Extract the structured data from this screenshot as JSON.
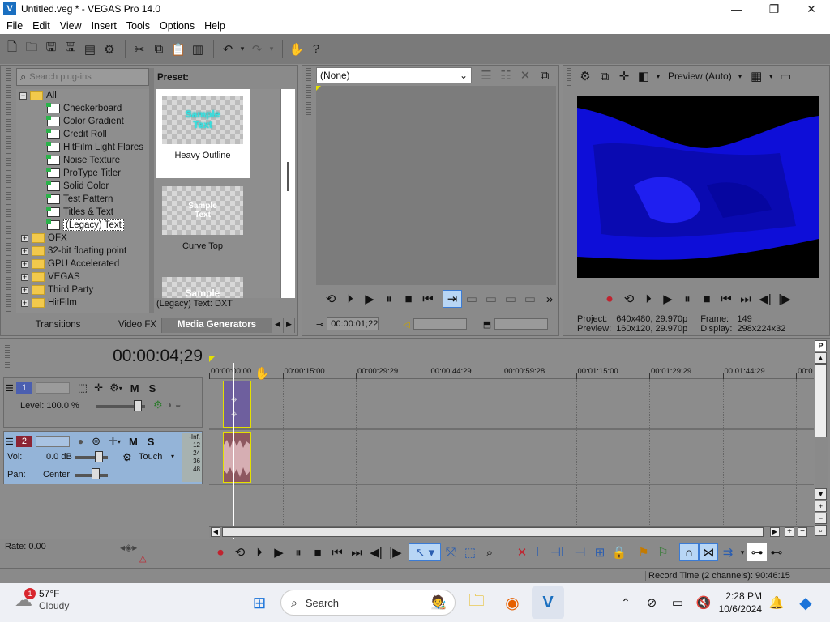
{
  "window": {
    "title": "Untitled.veg * - VEGAS Pro 14.0",
    "icon_letter": "V",
    "minimize": "—",
    "maximize": "❐",
    "close": "✕"
  },
  "menu": [
    "File",
    "Edit",
    "View",
    "Insert",
    "Tools",
    "Options",
    "Help"
  ],
  "explorer": {
    "search_placeholder": "Search plug-ins",
    "preset_label": "Preset:",
    "tree": [
      {
        "label": "All",
        "kind": "folder",
        "expanded": true
      },
      {
        "label": "Checkerboard",
        "kind": "gen"
      },
      {
        "label": "Color Gradient",
        "kind": "gen"
      },
      {
        "label": "Credit Roll",
        "kind": "gen"
      },
      {
        "label": "HitFilm Light Flares",
        "kind": "gen"
      },
      {
        "label": "Noise Texture",
        "kind": "gen"
      },
      {
        "label": "ProType Titler",
        "kind": "gen"
      },
      {
        "label": "Solid Color",
        "kind": "gen"
      },
      {
        "label": "Test Pattern",
        "kind": "gen"
      },
      {
        "label": "Titles & Text",
        "kind": "gen"
      },
      {
        "label": "(Legacy) Text",
        "kind": "gen",
        "selected": true
      },
      {
        "label": "OFX",
        "kind": "folder"
      },
      {
        "label": "32-bit floating point",
        "kind": "folder"
      },
      {
        "label": "GPU Accelerated",
        "kind": "folder"
      },
      {
        "label": "VEGAS",
        "kind": "folder"
      },
      {
        "label": "Third Party",
        "kind": "folder"
      },
      {
        "label": "HitFilm",
        "kind": "folder"
      }
    ],
    "presets": [
      {
        "label": "Heavy Outline",
        "sample": "Sample Text"
      },
      {
        "label": "Curve Top",
        "sample": "Sample Text"
      },
      {
        "label": "",
        "sample": "Sample"
      }
    ],
    "status": "(Legacy) Text: DXT",
    "tabs": [
      "Transitions",
      "Video FX",
      "Media Generators"
    ]
  },
  "trimmer": {
    "dropdown": "(None)",
    "timecode": "00:00:01;22"
  },
  "preview": {
    "mode": "Preview (Auto)",
    "project_label": "Project:",
    "project_value": "640x480, 29.970p",
    "preview_label": "Preview:",
    "preview_value": "160x120, 29.970p",
    "frame_label": "Frame:",
    "frame_value": "149",
    "display_label": "Display:",
    "display_value": "298x224x32"
  },
  "timeline": {
    "timecode": "00:00:04;29",
    "ruler": [
      "00:00:00:00",
      "00:00:15:00",
      "00:00:29:29",
      "00:00:44:29",
      "00:00:59:28",
      "00:01:15:00",
      "00:01:29:29",
      "00:01:44:29",
      "00:0"
    ],
    "track1": {
      "num": "1",
      "level_label": "Level: 100.0 %",
      "m": "M",
      "s": "S"
    },
    "track2": {
      "num": "2",
      "vol_label": "Vol:",
      "vol_value": "0.0 dB",
      "pan_label": "Pan:",
      "pan_value": "Center",
      "touch": "Touch",
      "m": "M",
      "s": "S",
      "meter": [
        "-Inf.",
        "12",
        "24",
        "36",
        "48"
      ]
    }
  },
  "rate": "Rate: 0.00",
  "status_record": "Record Time (2 channels): 90:46:15",
  "taskbar": {
    "weather_temp": "57°F",
    "weather_desc": "Cloudy",
    "weather_badge": "1",
    "search": "Search",
    "time": "2:28 PM",
    "date": "10/6/2024"
  }
}
